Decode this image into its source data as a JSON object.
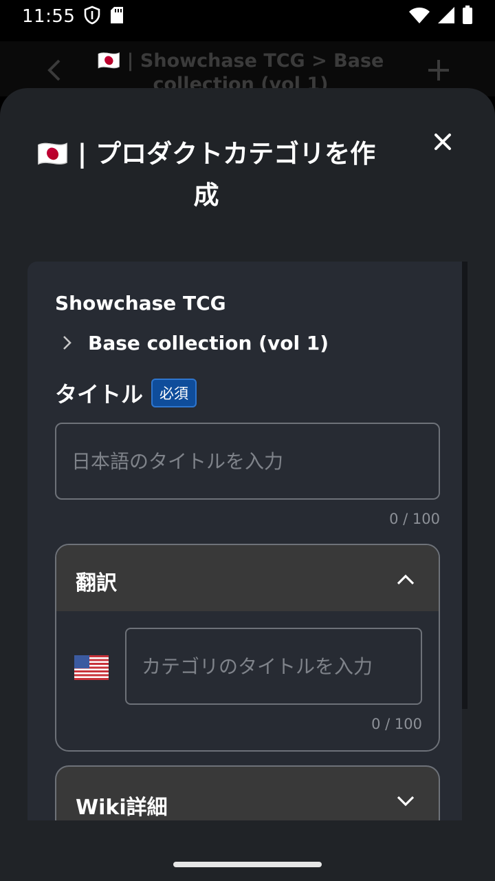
{
  "status_bar": {
    "time": "11:55",
    "icons": [
      "shield-icon",
      "sd-card-icon",
      "wifi-icon",
      "signal-icon",
      "battery-icon"
    ]
  },
  "background_header": {
    "title": "🇯🇵 | Showchase TCG > Base collection (vol 1)",
    "icons": [
      "back-arrow-icon",
      "plus-icon"
    ]
  },
  "sheet": {
    "title": "🇯🇵 | プロダクトカテゴリを作成",
    "close_icon": "close-icon",
    "breadcrumb": {
      "root": "Showchase TCG",
      "child": "Base collection (vol 1)"
    },
    "title_field": {
      "label": "タイトル",
      "badge": "必須",
      "placeholder": "日本語のタイトルを入力",
      "value": "",
      "counter": "0 / 100"
    },
    "translations": {
      "header": "翻訳",
      "expanded": true,
      "items": [
        {
          "flag": "🇺🇸",
          "placeholder": "カテゴリのタイトルを入力",
          "value": "",
          "counter": "0 / 100"
        }
      ]
    },
    "wiki": {
      "header": "Wiki詳細",
      "expanded": false
    }
  },
  "colors": {
    "sheet_bg": "#202327",
    "card_bg": "#272b33",
    "accordion_header_bg": "#393939",
    "badge_bg": "#0f4d9b",
    "border": "#6e7279"
  }
}
